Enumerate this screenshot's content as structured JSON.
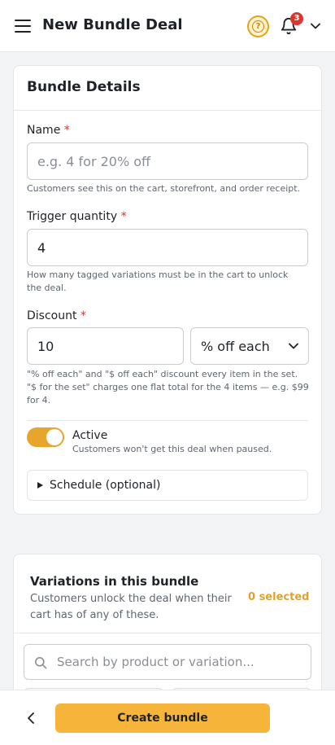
{
  "header": {
    "title": "New Bundle Deal",
    "help_icon": "question-mark-icon",
    "help_symbol": "?",
    "notifications_count": "3",
    "accent": "#e8a317",
    "badge_color": "#e0342e"
  },
  "details": {
    "title": "Bundle Details",
    "name": {
      "label": "Name",
      "required": "*",
      "placeholder": "e.g. 4 for 20% off",
      "value": "",
      "help": "Customers see this on the cart, storefront, and order receipt."
    },
    "trigger": {
      "label": "Trigger quantity",
      "required": "*",
      "value": "4",
      "help": "How many tagged variations must be in the cart to unlock the deal."
    },
    "discount": {
      "label": "Discount",
      "required": "*",
      "value": "10",
      "type_selected": "% off each",
      "help": "\"% off each\" and \"$ off each\" discount every item in the set. \"$ for the set\" charges one flat total for the 4 items — e.g. $99 for 4."
    },
    "active": {
      "label": "Active",
      "help": "Customers won't get this deal when paused.",
      "on": true,
      "color": "#e8a52c"
    },
    "schedule": {
      "label": "Schedule (optional)"
    }
  },
  "variations": {
    "title": "Variations in this bundle",
    "description": "Customers unlock the deal when their cart has of any of these.",
    "selected_count": "0 selected",
    "search_placeholder": "Search by product or variation..."
  },
  "footer": {
    "create_label": "Create bundle",
    "button_color": "#f7b43a"
  }
}
